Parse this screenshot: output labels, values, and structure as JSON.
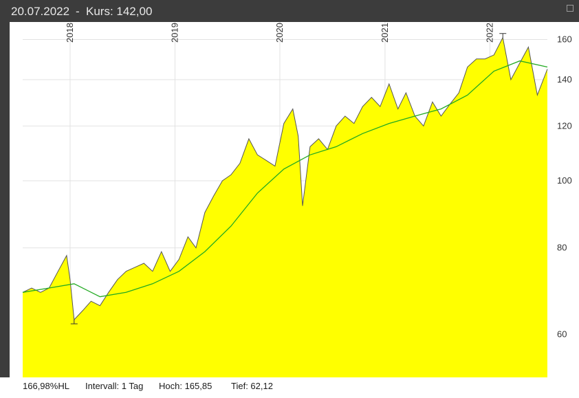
{
  "header": {
    "date": "20.07.2022",
    "separator": "-",
    "kurs": "Kurs: 142,00"
  },
  "footer": {
    "hl": "166,98%HL",
    "intervall": "Intervall: 1 Tag",
    "hoch": "Hoch:  165,85",
    "tief": "Tief:  62,12"
  },
  "chart_data": {
    "type": "area",
    "title": "",
    "xlabel": "",
    "ylabel": "",
    "y_scale": "log",
    "ylim": [
      52,
      165
    ],
    "x_tick_labels": [
      "2018",
      "2019",
      "2020",
      "2021",
      "2022"
    ],
    "y_tick_labels": [
      "60",
      "80",
      "100",
      "120",
      "140",
      "160"
    ],
    "y_ticks": [
      60,
      80,
      100,
      120,
      140,
      160
    ],
    "grid": true,
    "colors": {
      "area_fill": "#ffff00",
      "price_line": "#555555",
      "moving_average": "#22aa22",
      "grid": "#e2e2e2"
    },
    "series": [
      {
        "x": [
          "2017-07-20",
          "2017-08-20",
          "2017-09-20",
          "2017-10-20",
          "2017-11-20",
          "2017-12-20",
          "2018-01-01",
          "2018-01-15",
          "2018-02-15",
          "2018-03-15",
          "2018-04-15",
          "2018-05-15",
          "2018-06-15",
          "2018-07-15",
          "2018-08-15",
          "2018-09-15",
          "2018-10-15",
          "2018-11-15",
          "2018-12-15",
          "2019-01-15",
          "2019-02-15",
          "2019-03-15",
          "2019-04-15",
          "2019-05-15",
          "2019-06-15",
          "2019-07-15",
          "2019-08-15",
          "2019-09-15",
          "2019-10-15",
          "2019-11-15",
          "2019-12-15",
          "2020-01-15",
          "2020-02-15",
          "2020-03-05",
          "2020-03-20",
          "2020-04-15",
          "2020-05-15",
          "2020-06-15",
          "2020-07-15",
          "2020-08-15",
          "2020-09-15",
          "2020-10-15",
          "2020-11-15",
          "2020-12-15",
          "2021-01-15",
          "2021-02-15",
          "2021-03-15",
          "2021-04-15",
          "2021-05-15",
          "2021-06-15",
          "2021-07-15",
          "2021-08-15",
          "2021-09-15",
          "2021-10-15",
          "2021-11-15",
          "2021-12-15",
          "2022-01-15",
          "2022-02-15",
          "2022-03-15",
          "2022-04-15",
          "2022-05-15",
          "2022-06-15",
          "2022-07-20"
        ],
        "values": [
          69,
          70,
          69,
          70,
          74,
          78,
          72,
          63,
          65,
          67,
          66,
          69,
          72,
          74,
          75,
          76,
          74,
          79,
          74,
          77,
          83,
          80,
          90,
          95,
          100,
          102,
          106,
          115,
          109,
          107,
          105,
          121,
          127,
          116,
          92,
          112,
          115,
          111,
          120,
          124,
          121,
          128,
          132,
          128,
          138,
          127,
          134,
          124,
          120,
          130,
          124,
          129,
          134,
          146,
          150,
          150,
          152,
          161,
          140,
          148,
          156,
          133,
          145
        ],
        "name": ""
      },
      {
        "x": [
          "2017-07-20",
          "2017-10-20",
          "2018-01-15",
          "2018-04-15",
          "2018-07-15",
          "2018-10-15",
          "2019-01-15",
          "2019-04-15",
          "2019-07-15",
          "2019-10-15",
          "2020-01-15",
          "2020-04-15",
          "2020-07-15",
          "2020-10-15",
          "2021-01-15",
          "2021-04-15",
          "2021-07-15",
          "2021-10-15",
          "2022-01-15",
          "2022-04-15",
          "2022-07-20"
        ],
        "values": [
          69,
          70,
          71,
          68,
          69,
          71,
          74,
          79,
          86,
          96,
          104,
          109,
          112,
          117,
          121,
          124,
          127,
          133,
          144,
          149,
          146
        ],
        "name": ""
      }
    ]
  }
}
